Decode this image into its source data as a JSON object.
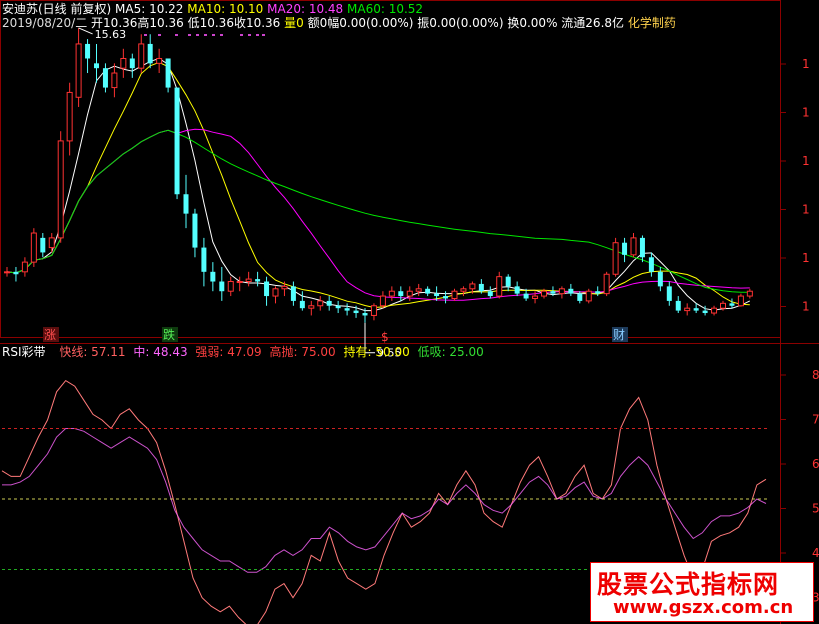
{
  "price_header": {
    "stock_name": "安迪苏(日线 前复权)",
    "ma5": "MA5: 10.22",
    "ma10": "MA10: 10.10",
    "ma20": "MA20: 10.48",
    "ma60": "MA60: 10.52",
    "date": "2019/08/20/二",
    "open": "开10.36",
    "high": "高10.36",
    "low": "低10.36",
    "close": "收10.36",
    "volume": "量0",
    "amount": "额0",
    "amplitude_rate": "幅0.00(0.00%)",
    "swing": "振0.00(0.00%)",
    "turnover": "换0.00%",
    "float_cap": "流通26.8亿",
    "sector": "化学制药"
  },
  "rsi_header": {
    "name": "RSI彩带",
    "fast": "快线: 57.11",
    "mid": "中: 48.43",
    "strong": "强弱: 47.09",
    "high_sell": "高抛: 75.00",
    "hold": "持有: 50.00",
    "low_buy": "低吸: 25.00"
  },
  "colors": {
    "up": "#ff3232",
    "down": "#54ffff",
    "ma5": "#ffffff",
    "ma10": "#ffff00",
    "ma20": "#ff00ff",
    "ma60": "#00e600",
    "rsi_above_light": "#ff9999",
    "rsi_above_dark": "#dd0000",
    "rsi_below_green": "#66cc66",
    "rsi_below_purple": "#9999ee",
    "line_75": "#cc2222",
    "line_50": "#cccc55",
    "line_25": "#22aa22"
  },
  "markers": {
    "zhang": "涨",
    "die": "跌",
    "dollar": "$",
    "cai": "财"
  },
  "watermark": {
    "title": "股票公式指标网",
    "url": "www.gszx.com.cn"
  },
  "chart_data": [
    {
      "type": "candlestick",
      "title": "安迪苏(日线 前复权)",
      "y_tick_labels": [
        "1",
        "1",
        "1",
        "1",
        "1",
        "1"
      ],
      "annotations": [
        {
          "text": "15.63",
          "at": "high"
        },
        {
          "text": "9.55",
          "at": "low"
        }
      ],
      "ylim": [
        9.4,
        16.0
      ],
      "candles": [
        [
          10.6,
          10.7,
          10.5,
          10.6
        ],
        [
          10.6,
          10.7,
          10.4,
          10.55
        ],
        [
          10.6,
          10.9,
          10.5,
          10.8
        ],
        [
          10.8,
          11.5,
          10.7,
          11.4
        ],
        [
          11.3,
          11.4,
          10.9,
          11.0
        ],
        [
          11.1,
          11.4,
          11.0,
          11.3
        ],
        [
          11.3,
          13.5,
          11.2,
          13.3
        ],
        [
          13.3,
          14.5,
          13.0,
          14.3
        ],
        [
          14.2,
          15.63,
          14.0,
          15.3
        ],
        [
          15.3,
          15.4,
          14.7,
          15.0
        ],
        [
          14.9,
          15.3,
          14.5,
          14.8
        ],
        [
          14.8,
          14.9,
          14.3,
          14.4
        ],
        [
          14.4,
          14.9,
          14.2,
          14.7
        ],
        [
          14.8,
          15.2,
          14.6,
          15.0
        ],
        [
          15.0,
          15.1,
          14.6,
          14.8
        ],
        [
          14.8,
          15.5,
          14.7,
          15.3
        ],
        [
          15.3,
          15.5,
          14.8,
          14.9
        ],
        [
          14.9,
          15.2,
          14.7,
          15.0
        ],
        [
          15.0,
          15.0,
          14.3,
          14.4
        ],
        [
          14.4,
          14.4,
          12.1,
          12.2
        ],
        [
          12.2,
          12.6,
          11.5,
          11.8
        ],
        [
          11.8,
          11.9,
          10.9,
          11.1
        ],
        [
          11.1,
          11.3,
          10.3,
          10.6
        ],
        [
          10.6,
          10.8,
          10.2,
          10.4
        ],
        [
          10.4,
          10.7,
          10.0,
          10.2
        ],
        [
          10.2,
          10.5,
          10.1,
          10.4
        ],
        [
          10.4,
          10.5,
          10.2,
          10.4
        ],
        [
          10.4,
          10.6,
          10.3,
          10.45
        ],
        [
          10.45,
          10.6,
          10.3,
          10.4
        ],
        [
          10.4,
          10.5,
          9.9,
          10.1
        ],
        [
          10.1,
          10.3,
          9.95,
          10.25
        ],
        [
          10.25,
          10.4,
          10.1,
          10.3
        ],
        [
          10.3,
          10.4,
          9.9,
          10.0
        ],
        [
          10.0,
          10.2,
          9.8,
          9.85
        ],
        [
          9.85,
          10.0,
          9.7,
          9.9
        ],
        [
          9.9,
          10.1,
          9.8,
          10.0
        ],
        [
          10.0,
          10.1,
          9.8,
          9.9
        ],
        [
          9.9,
          10.0,
          9.75,
          9.85
        ],
        [
          9.85,
          9.95,
          9.7,
          9.8
        ],
        [
          9.8,
          9.9,
          9.65,
          9.75
        ],
        [
          9.75,
          9.85,
          9.55,
          9.7
        ],
        [
          9.7,
          9.95,
          9.6,
          9.9
        ],
        [
          9.9,
          10.2,
          9.85,
          10.1
        ],
        [
          10.1,
          10.3,
          10.0,
          10.2
        ],
        [
          10.2,
          10.3,
          10.0,
          10.1
        ],
        [
          10.1,
          10.3,
          10.0,
          10.2
        ],
        [
          10.2,
          10.35,
          10.1,
          10.25
        ],
        [
          10.25,
          10.3,
          10.1,
          10.15
        ],
        [
          10.15,
          10.3,
          10.0,
          10.1
        ],
        [
          10.1,
          10.2,
          9.95,
          10.05
        ],
        [
          10.05,
          10.25,
          10.0,
          10.2
        ],
        [
          10.2,
          10.3,
          10.1,
          10.25
        ],
        [
          10.25,
          10.4,
          10.15,
          10.35
        ],
        [
          10.35,
          10.45,
          10.15,
          10.2
        ],
        [
          10.2,
          10.3,
          10.05,
          10.1
        ],
        [
          10.1,
          10.6,
          10.05,
          10.5
        ],
        [
          10.5,
          10.55,
          10.2,
          10.3
        ],
        [
          10.3,
          10.4,
          10.1,
          10.15
        ],
        [
          10.15,
          10.25,
          10.0,
          10.05
        ],
        [
          10.05,
          10.2,
          9.95,
          10.1
        ],
        [
          10.1,
          10.25,
          10.05,
          10.2
        ],
        [
          10.2,
          10.3,
          10.1,
          10.15
        ],
        [
          10.15,
          10.3,
          10.05,
          10.25
        ],
        [
          10.25,
          10.35,
          10.1,
          10.15
        ],
        [
          10.15,
          10.2,
          9.95,
          10.0
        ],
        [
          10.0,
          10.25,
          9.95,
          10.2
        ],
        [
          10.2,
          10.3,
          10.1,
          10.15
        ],
        [
          10.15,
          10.6,
          10.1,
          10.55
        ],
        [
          10.55,
          11.3,
          10.5,
          11.2
        ],
        [
          11.2,
          11.3,
          10.8,
          10.95
        ],
        [
          10.95,
          11.4,
          10.9,
          11.3
        ],
        [
          11.3,
          11.35,
          10.8,
          10.9
        ],
        [
          10.9,
          11.0,
          10.5,
          10.6
        ],
        [
          10.6,
          10.7,
          10.2,
          10.3
        ],
        [
          10.3,
          10.4,
          9.9,
          10.0
        ],
        [
          10.0,
          10.1,
          9.75,
          9.8
        ],
        [
          9.8,
          9.95,
          9.7,
          9.85
        ],
        [
          9.85,
          9.95,
          9.75,
          9.8
        ],
        [
          9.8,
          9.9,
          9.7,
          9.75
        ],
        [
          9.75,
          9.9,
          9.7,
          9.85
        ],
        [
          9.85,
          10.0,
          9.8,
          9.95
        ],
        [
          9.95,
          10.05,
          9.85,
          9.9
        ],
        [
          9.9,
          10.15,
          9.88,
          10.1
        ],
        [
          10.1,
          10.25,
          10.05,
          10.2
        ]
      ]
    },
    {
      "type": "area",
      "title": "RSI彩带",
      "ylim": [
        0,
        100
      ],
      "y_tick_labels": [
        "8",
        "7",
        "6",
        "5",
        "4",
        "3"
      ],
      "reference_lines": [
        75,
        50,
        25
      ],
      "series": [
        {
          "name": "快线",
          "values": [
            60,
            58,
            58,
            65,
            72,
            78,
            88,
            92,
            90,
            85,
            80,
            78,
            75,
            80,
            82,
            78,
            75,
            70,
            60,
            48,
            35,
            22,
            15,
            12,
            10,
            12,
            8,
            5,
            5,
            10,
            18,
            20,
            15,
            20,
            30,
            28,
            38,
            28,
            22,
            20,
            18,
            20,
            30,
            38,
            45,
            40,
            42,
            45,
            52,
            48,
            55,
            60,
            55,
            45,
            42,
            40,
            48,
            56,
            62,
            65,
            58,
            50,
            52,
            58,
            62,
            52,
            50,
            55,
            75,
            82,
            86,
            78,
            62,
            50,
            40,
            30,
            22,
            25,
            35,
            37,
            38,
            40,
            45,
            55,
            57
          ]
        },
        {
          "name": "中",
          "values": [
            55,
            55,
            56,
            58,
            62,
            66,
            72,
            75,
            75,
            74,
            72,
            70,
            68,
            70,
            72,
            70,
            68,
            64,
            56,
            46,
            40,
            36,
            32,
            30,
            28,
            28,
            26,
            24,
            24,
            26,
            30,
            32,
            30,
            32,
            36,
            36,
            40,
            38,
            35,
            33,
            32,
            33,
            37,
            41,
            45,
            43,
            44,
            46,
            50,
            48,
            52,
            55,
            52,
            48,
            46,
            45,
            48,
            52,
            56,
            58,
            55,
            50,
            51,
            54,
            56,
            51,
            50,
            52,
            58,
            62,
            65,
            62,
            56,
            50,
            45,
            40,
            36,
            38,
            42,
            44,
            44,
            45,
            47,
            50,
            48.4
          ]
        }
      ]
    }
  ]
}
